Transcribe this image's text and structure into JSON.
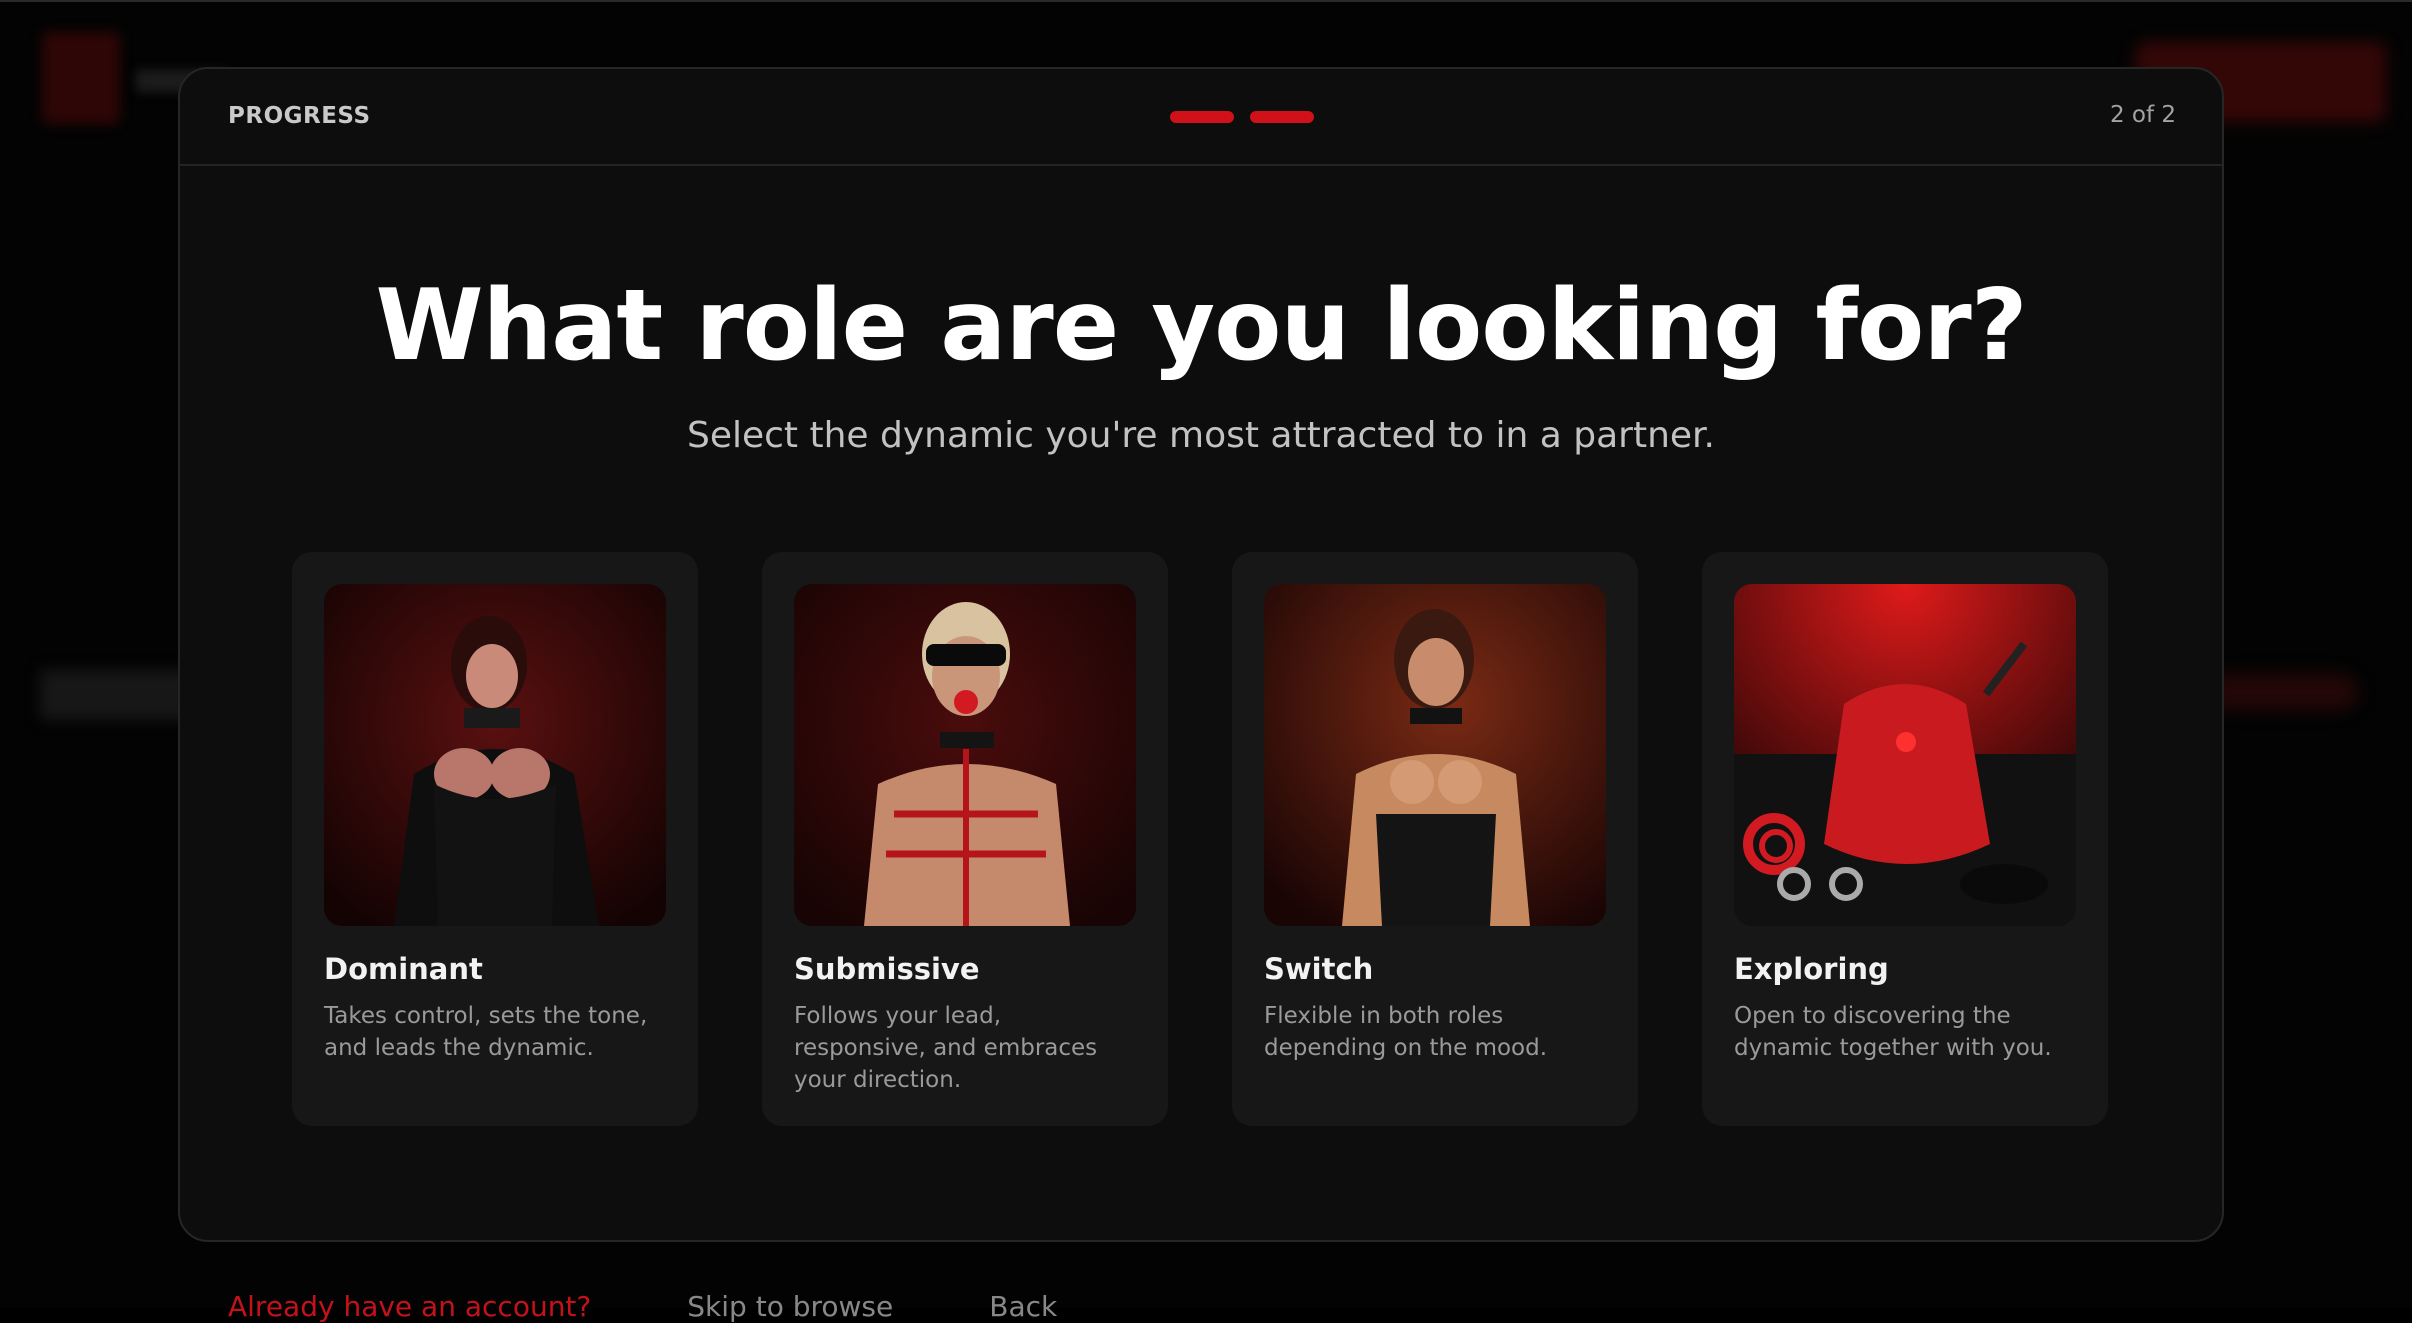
{
  "progress": {
    "label": "PROGRESS",
    "current_step": 2,
    "total_steps": 2,
    "step_text": "2 of 2",
    "accent_color": "#d0111a"
  },
  "question": {
    "title": "What role are you looking for?",
    "subtitle": "Select the dynamic you're most attracted to in a partner."
  },
  "options": [
    {
      "title": "Dominant",
      "description": "Takes control, sets the tone, and leads the dynamic.",
      "image": "dominant-photo"
    },
    {
      "title": "Submissive",
      "description": "Follows your lead, responsive, and embraces your direction.",
      "image": "submissive-photo"
    },
    {
      "title": "Switch",
      "description": "Flexible in both roles depending on the mood.",
      "image": "switch-photo"
    },
    {
      "title": "Exploring",
      "description": "Open to discovering the dynamic together with you.",
      "image": "exploring-photo"
    }
  ],
  "footer": {
    "login_link": "Already have an account?",
    "skip_link": "Skip to browse",
    "back_link": "Back"
  }
}
